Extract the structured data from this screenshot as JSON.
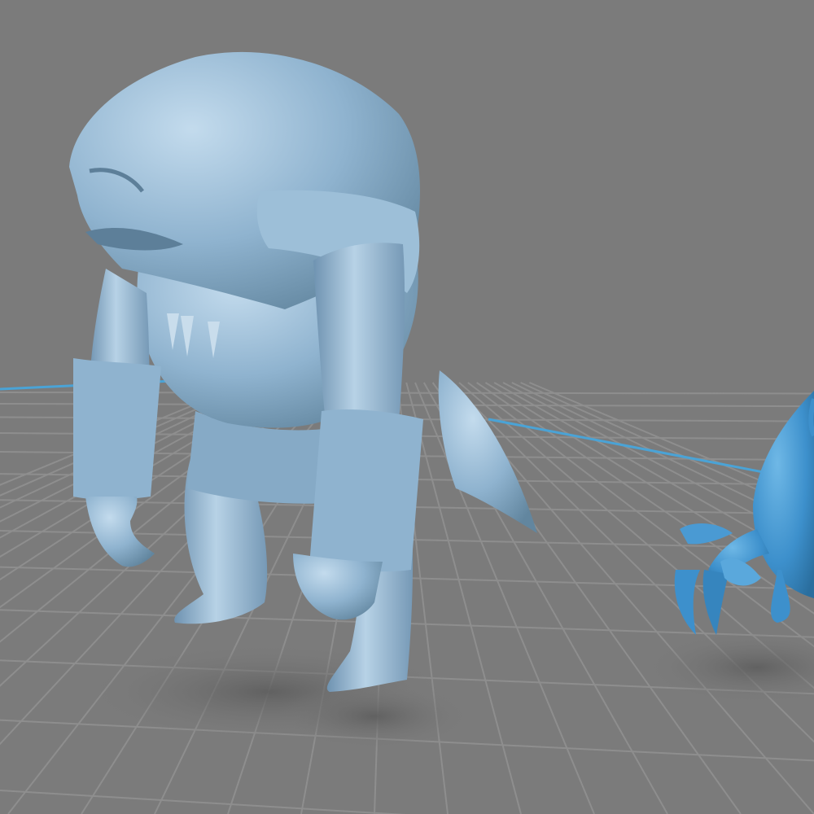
{
  "viewport": {
    "background_color": "#7b7b7b",
    "grid_line_color": "#8e8e8e",
    "axis_color": "#4aa3d6",
    "shadow_color": "#6a6a6a"
  },
  "models": [
    {
      "name": "fishman-warrior",
      "color": "#8fb3cf",
      "highlight": "#b7d2e6",
      "shade": "#6f93b1"
    },
    {
      "name": "crab",
      "color": "#3d90cc",
      "highlight": "#69b4e4",
      "shade": "#2b6f9f"
    }
  ]
}
